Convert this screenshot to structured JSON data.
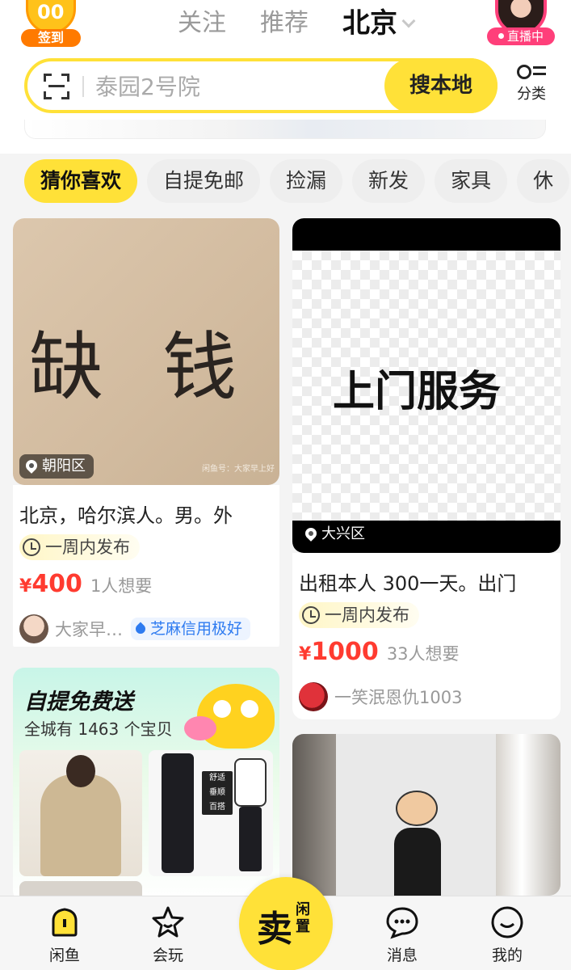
{
  "header": {
    "signin_label": "签到",
    "tabs": [
      "关注",
      "推荐",
      "北京"
    ],
    "live_label": "直播中"
  },
  "search": {
    "placeholder": "泰园2号院",
    "button_label": "搜本地",
    "category_label": "分类"
  },
  "chips": [
    "猜你喜欢",
    "自提免邮",
    "捡漏",
    "新发",
    "家具",
    "休"
  ],
  "feed": {
    "left_item": {
      "image_text": "缺 钱",
      "watermark": "闲鱼号：大家早上好",
      "location": "朝阳区",
      "title": "北京，哈尔滨人。男。外",
      "time_tag": "一周内发布",
      "currency": "¥",
      "price": "400",
      "wants": "1人想要",
      "seller": "大家早…",
      "credit": "芝麻信用极好"
    },
    "right_item": {
      "image_text": "上门服务",
      "location": "大兴区",
      "title": "出租本人 300一天。出门",
      "time_tag": "一周内发布",
      "currency": "¥",
      "price": "1000",
      "wants": "33人想要",
      "seller": "一笑泯恩仇1003"
    },
    "promo": {
      "title": "自提免费送",
      "subtitle": "全城有 1463 个宝贝",
      "tag_lines": [
        "舒适",
        "垂顺",
        "百搭"
      ]
    }
  },
  "bottom_nav": {
    "items": [
      "闲鱼",
      "会玩",
      "消息",
      "我的"
    ],
    "sell_main": "卖",
    "sell_sub": "闲置"
  },
  "colors": {
    "brand_yellow": "#ffe138",
    "price_red": "#ff3b30",
    "credit_blue": "#2e7bf0",
    "live_pink": "#ff3f7a"
  }
}
